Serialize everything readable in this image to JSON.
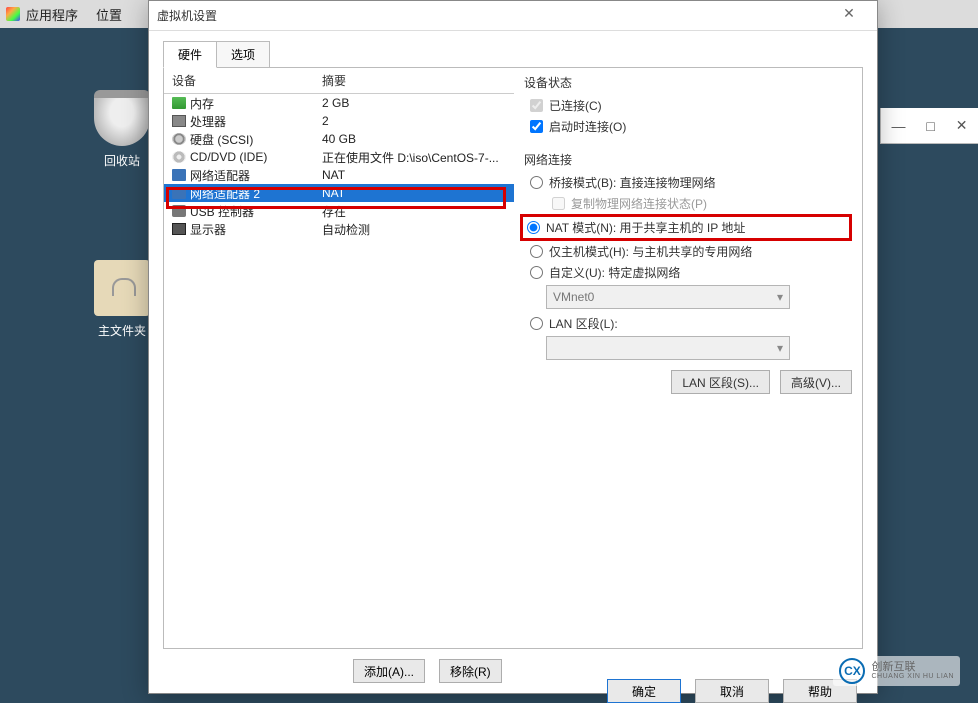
{
  "desktop": {
    "menubar": {
      "apps": "应用程序",
      "places": "位置"
    },
    "trash_label": "回收站",
    "home_label": "主文件夹",
    "window_controls": {
      "min": "—",
      "max": "□",
      "close": "✕"
    }
  },
  "dialog": {
    "title": "虚拟机设置",
    "close_glyph": "✕",
    "tabs": {
      "hardware": "硬件",
      "options": "选项"
    },
    "columns": {
      "device": "设备",
      "summary": "摘要"
    },
    "devices": [
      {
        "name": "内存",
        "summary": "2 GB",
        "icon": "mem"
      },
      {
        "name": "处理器",
        "summary": "2",
        "icon": "cpu"
      },
      {
        "name": "硬盘 (SCSI)",
        "summary": "40 GB",
        "icon": "disk"
      },
      {
        "name": "CD/DVD (IDE)",
        "summary": "正在使用文件 D:\\iso\\CentOS-7-...",
        "icon": "cd"
      },
      {
        "name": "网络适配器",
        "summary": "NAT",
        "icon": "net"
      },
      {
        "name": "网络适配器 2",
        "summary": "NAT",
        "icon": "net",
        "selected": true,
        "highlighted": true
      },
      {
        "name": "USB 控制器",
        "summary": "存在",
        "icon": "usb"
      },
      {
        "name": "显示器",
        "summary": "自动检测",
        "icon": "display"
      }
    ],
    "buttons": {
      "add": "添加(A)...",
      "remove": "移除(R)"
    },
    "right": {
      "status_title": "设备状态",
      "connected": "已连接(C)",
      "connect_on_start": "启动时连接(O)",
      "netconn_title": "网络连接",
      "bridge": "桥接模式(B): 直接连接物理网络",
      "replicate": "复制物理网络连接状态(P)",
      "nat": "NAT 模式(N): 用于共享主机的 IP 地址",
      "hostonly": "仅主机模式(H): 与主机共享的专用网络",
      "custom": "自定义(U): 特定虚拟网络",
      "vmnet_value": "VMnet0",
      "lan": "LAN 区段(L):",
      "btn_lan": "LAN 区段(S)...",
      "btn_adv": "高级(V)..."
    },
    "footer": {
      "ok": "确定",
      "cancel": "取消",
      "help": "帮助"
    }
  },
  "watermark": {
    "brand": "创新互联",
    "sub": "CHUANG XIN HU LIAN"
  }
}
